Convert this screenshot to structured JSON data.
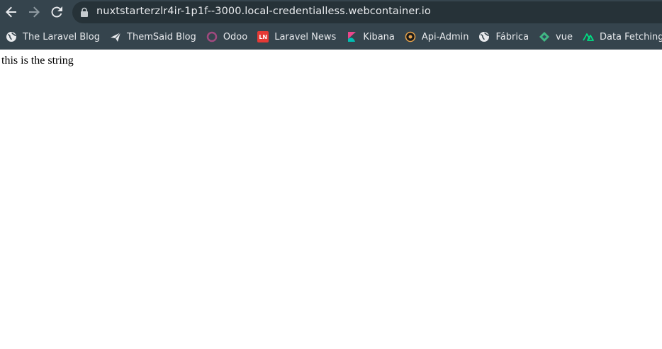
{
  "browser": {
    "url": "nuxtstarterzlr4ir-1p1f--3000.local-credentialless.webcontainer.io",
    "bookmarks": [
      {
        "label": "The Laravel Blog",
        "icon": "globe-icon"
      },
      {
        "label": "ThemSaid Blog",
        "icon": "bird-icon"
      },
      {
        "label": "Odoo",
        "icon": "odoo-icon"
      },
      {
        "label": "Laravel News",
        "icon": "laravel-news-icon",
        "icon_text": "LN"
      },
      {
        "label": "Kibana",
        "icon": "kibana-icon"
      },
      {
        "label": "Api-Admin",
        "icon": "api-admin-icon"
      },
      {
        "label": "Fábrica",
        "icon": "globe-icon"
      },
      {
        "label": "vue",
        "icon": "diamond-icon"
      },
      {
        "label": "Data Fetching · G...",
        "icon": "nuxt-icon"
      }
    ]
  },
  "page": {
    "text": "this is the string"
  },
  "colors": {
    "chrome_bg": "#35444d",
    "omnibox_bg": "#263238",
    "laravel_news_red": "#e53935",
    "odoo_purple": "#a0497f",
    "kibana_pink": "#e8478b",
    "kibana_teal": "#00bfb3",
    "vue_green": "#41b883",
    "nuxt_green": "#00dc82"
  }
}
